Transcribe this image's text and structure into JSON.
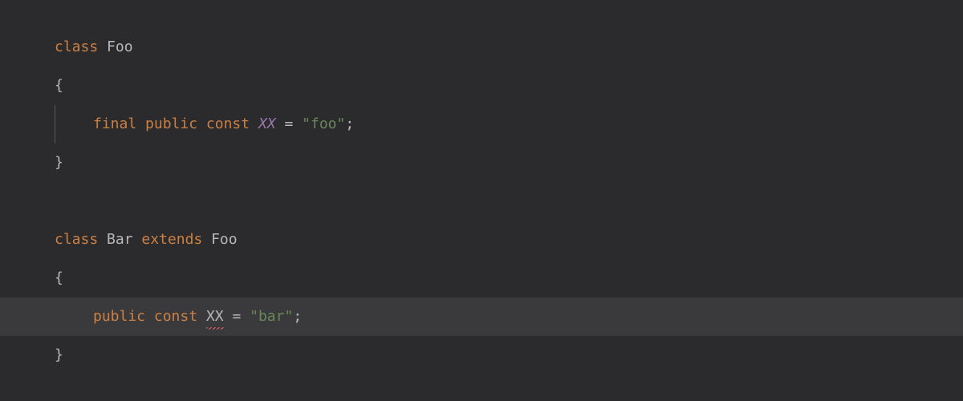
{
  "code": {
    "line1": {
      "kw_class": "class",
      "name": "Foo"
    },
    "line2": {
      "brace": "{"
    },
    "line3": {
      "kw_final": "final",
      "kw_public": "public",
      "kw_const": "const",
      "const_name": "XX",
      "op_eq": "=",
      "string": "\"foo\"",
      "semi": ";"
    },
    "line4": {
      "brace": "}"
    },
    "line6": {
      "kw_class": "class",
      "name": "Bar",
      "kw_extends": "extends",
      "parent": "Foo"
    },
    "line7": {
      "brace": "{"
    },
    "line8": {
      "kw_public": "public",
      "kw_const": "const",
      "const_name": "XX",
      "op_eq": "=",
      "string": "\"bar\"",
      "semi": ";"
    },
    "line9": {
      "brace": "}"
    }
  }
}
